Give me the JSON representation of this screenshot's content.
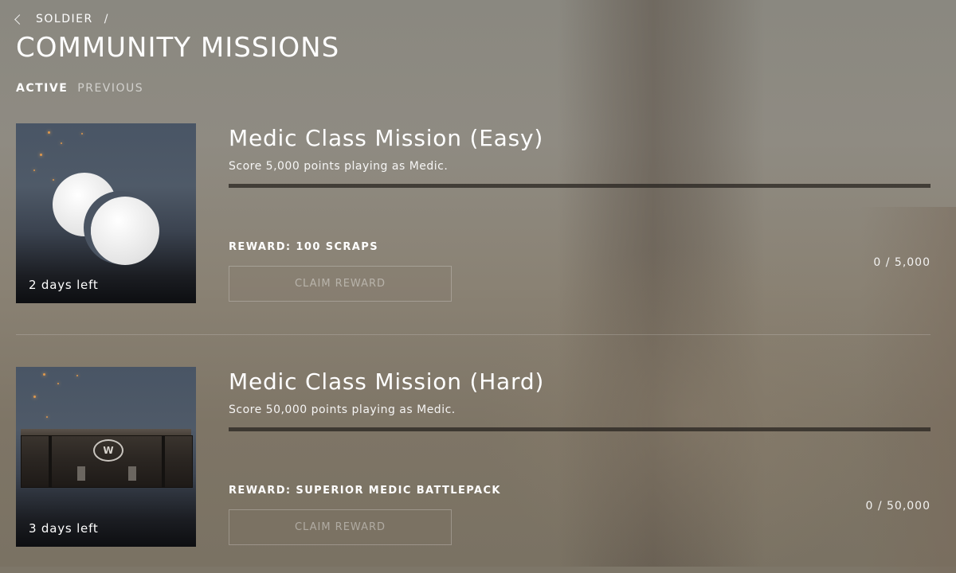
{
  "breadcrumb": {
    "back_icon": "chevron-left-icon",
    "parent": "SOLDIER",
    "separator": "/"
  },
  "page_title": "COMMUNITY MISSIONS",
  "tabs": [
    {
      "label": "ACTIVE",
      "active": true
    },
    {
      "label": "PREVIOUS",
      "active": false
    }
  ],
  "missions": [
    {
      "title": "Medic Class Mission (Easy)",
      "description": "Score 5,000 points playing as Medic.",
      "progress_current": 0,
      "progress_total": 5000,
      "progress_text": "0 / 5,000",
      "reward": "REWARD: 100 SCRAPS",
      "claim_label": "CLAIM REWARD",
      "time_left": "2 days left",
      "image": "scraps-coins-icon"
    },
    {
      "title": "Medic Class Mission (Hard)",
      "description": "Score 50,000 points playing as Medic.",
      "progress_current": 0,
      "progress_total": 50000,
      "progress_text": "0 / 50,000",
      "reward": "REWARD: SUPERIOR MEDIC BATTLEPACK",
      "claim_label": "CLAIM REWARD",
      "time_left": "3 days left",
      "image": "battlepack-crate-icon"
    }
  ],
  "colors": {
    "text": "#ffffff",
    "muted_text": "#bdbab4",
    "progress_track": "#2e2a26"
  }
}
